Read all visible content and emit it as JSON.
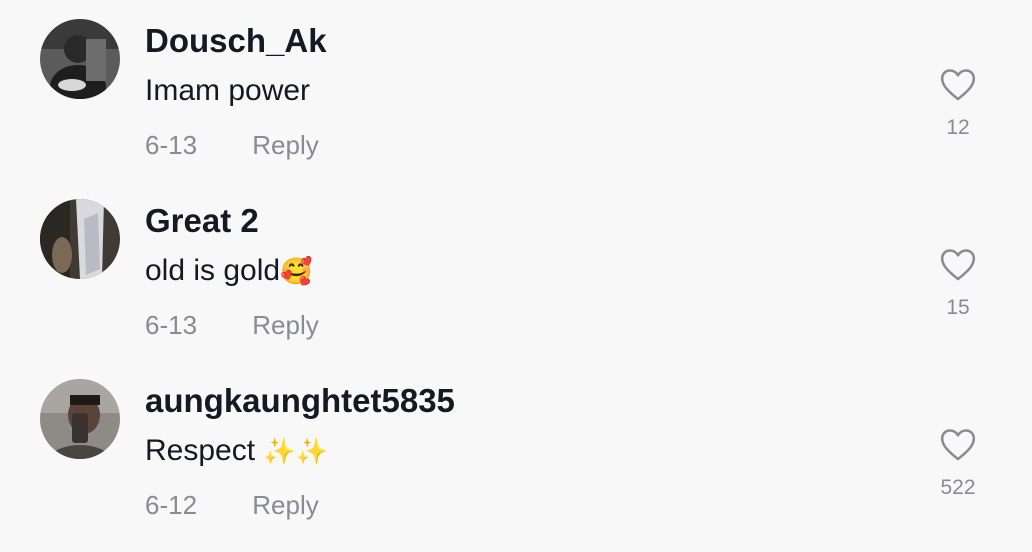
{
  "comments": [
    {
      "username": "Dousch_Ak",
      "text": "Imam power",
      "emoji": "",
      "date": "6-13",
      "reply_label": "Reply",
      "likes": "12"
    },
    {
      "username": "Great 2",
      "text": "old is gold",
      "emoji": "🥰",
      "date": "6-13",
      "reply_label": "Reply",
      "likes": "15"
    },
    {
      "username": "aungkaunghtet5835",
      "text": "Respect ",
      "emoji": "✨✨",
      "date": "6-12",
      "reply_label": "Reply",
      "likes": "522"
    }
  ],
  "icons": {
    "like": "heart-outline-icon"
  },
  "colors": {
    "background": "#f8f8f8",
    "primary_text": "#161823",
    "secondary_text": "#8a8b91"
  }
}
